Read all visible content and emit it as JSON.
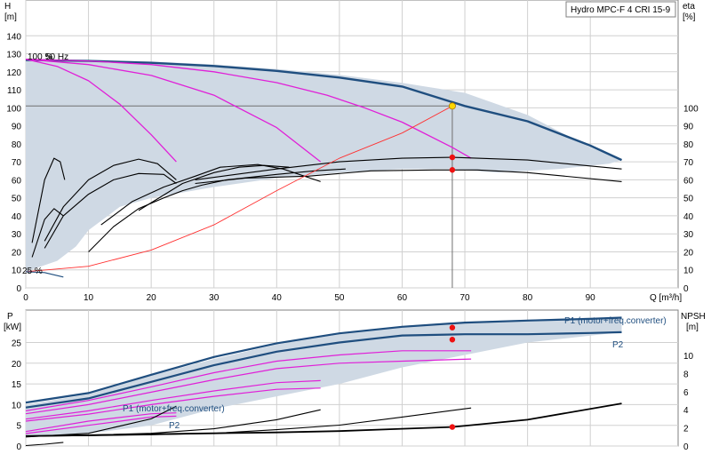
{
  "chart_data": [
    {
      "type": "line",
      "title_box": "Hydro MPC-F 4 CRI 15-9",
      "x_label": "Q [m³/h]",
      "y_left_label_1": "H",
      "y_left_label_2": "[m]",
      "y_right_label_1": "eta",
      "y_right_label_2": "[%]",
      "xlim": [
        0,
        104
      ],
      "ylim": [
        0,
        150
      ],
      "x_ticks": [
        0,
        10,
        20,
        30,
        40,
        50,
        60,
        70,
        80,
        90
      ],
      "y_left_ticks": [
        0,
        10,
        20,
        30,
        40,
        50,
        60,
        70,
        80,
        90,
        100,
        110,
        120,
        130,
        140
      ],
      "y_right_ticks": [
        0,
        10,
        20,
        30,
        40,
        50,
        60,
        70,
        80,
        90,
        100
      ],
      "annotations": {
        "max_speed": "100 %",
        "frequency": "50 Hz",
        "min_speed": "25 %"
      },
      "colors": {
        "region_fill": "#cfd9e4",
        "max_curve": "#1f4e7f",
        "pump_curves": "#e020d8",
        "efficiency": "#000000",
        "system_curve": "#ff3030",
        "duty_point": "#ffd700"
      },
      "operating_region": [
        [
          0,
          127
        ],
        [
          10,
          126.6
        ],
        [
          20,
          125.7
        ],
        [
          30,
          124.1
        ],
        [
          40,
          121.6
        ],
        [
          50,
          118.3
        ],
        [
          60,
          113.9
        ],
        [
          70,
          108.3
        ],
        [
          80,
          96
        ],
        [
          90,
          78
        ],
        [
          95,
          71
        ],
        [
          93,
          69
        ],
        [
          85,
          66
        ],
        [
          75,
          64
        ],
        [
          68,
          66
        ],
        [
          60,
          66
        ],
        [
          50,
          64
        ],
        [
          40,
          61
        ],
        [
          30,
          56
        ],
        [
          20,
          50
        ],
        [
          15,
          45
        ],
        [
          10,
          32
        ],
        [
          8,
          23
        ],
        [
          5,
          15
        ],
        [
          0,
          9
        ]
      ],
      "series": [
        {
          "kind": "max",
          "x": [
            0,
            10,
            20,
            30,
            40,
            50,
            60,
            70,
            80,
            90,
            95
          ],
          "y": [
            126.5,
            126,
            125,
            123.2,
            120.5,
            116.8,
            111.8,
            101,
            92.5,
            79,
            71
          ]
        },
        {
          "kind": "pump",
          "x": [
            0,
            10,
            20,
            30,
            40,
            48,
            54,
            60,
            68,
            71
          ],
          "y": [
            127,
            126,
            124,
            120,
            114,
            107,
            100,
            92,
            78,
            72
          ]
        },
        {
          "kind": "pump",
          "x": [
            0,
            10,
            20,
            30,
            40,
            47
          ],
          "y": [
            127,
            124,
            118,
            107,
            89,
            70
          ]
        },
        {
          "kind": "pump",
          "x": [
            0,
            5,
            10,
            15,
            20,
            24
          ],
          "y": [
            127,
            123,
            115,
            102,
            85,
            70
          ]
        },
        {
          "kind": "eta",
          "x": [
            27,
            35,
            45,
            55,
            65,
            72,
            80,
            95
          ],
          "y": [
            58,
            61,
            62,
            65,
            65.5,
            65.5,
            64,
            59
          ]
        },
        {
          "kind": "eta",
          "x": [
            27,
            40,
            50,
            60,
            68,
            80,
            95
          ],
          "y": [
            60,
            66,
            70,
            72,
            72.5,
            71,
            66
          ]
        },
        {
          "kind": "eta",
          "x": [
            10,
            14,
            18,
            22,
            25,
            28,
            32,
            40,
            46,
            51
          ],
          "y": [
            20,
            34,
            44,
            50,
            54,
            57,
            60,
            63,
            65,
            66
          ]
        },
        {
          "kind": "eta",
          "x": [
            12,
            17,
            22,
            27,
            31,
            37,
            41,
            47
          ],
          "y": [
            35,
            48,
            56,
            62,
            67,
            68.5,
            66,
            59
          ]
        },
        {
          "kind": "eta",
          "x": [
            18,
            25,
            30,
            34,
            38,
            42
          ],
          "y": [
            43,
            58,
            64,
            67,
            68,
            67
          ]
        },
        {
          "kind": "eta",
          "x": [
            3,
            6,
            10,
            14,
            18,
            21,
            24
          ],
          "y": [
            26,
            45,
            60,
            68,
            71.5,
            69,
            60
          ]
        },
        {
          "kind": "eta",
          "x": [
            3,
            6,
            10,
            14,
            18,
            22,
            24
          ],
          "y": [
            22,
            40,
            52,
            60,
            63.5,
            63,
            58
          ]
        },
        {
          "kind": "eta",
          "x": [
            1,
            3,
            4.5,
            5.5,
            6.2
          ],
          "y": [
            25,
            60,
            72,
            70,
            60
          ]
        },
        {
          "kind": "eta",
          "x": [
            1,
            3,
            4.5,
            6
          ],
          "y": [
            17,
            38,
            44,
            40
          ]
        },
        {
          "kind": "system",
          "x": [
            0,
            10,
            20,
            30,
            40,
            50,
            60,
            68
          ],
          "y": [
            9,
            12,
            21,
            35,
            54,
            72,
            86,
            101
          ]
        }
      ],
      "duty_point": {
        "x": 68,
        "y": 101
      },
      "eta_points": [
        {
          "x": 68,
          "y": 72.5
        },
        {
          "x": 68,
          "y": 65.5
        }
      ]
    },
    {
      "type": "line",
      "y_left_label_1": "P",
      "y_left_label_2": "[kW]",
      "y_right_label_1": "NPSH",
      "y_right_label_2": "[m]",
      "xlim": [
        0,
        104
      ],
      "ylim": [
        0,
        32.5
      ],
      "y_left_ticks": [
        0,
        5,
        10,
        15,
        20,
        25
      ],
      "y_right_ticks": [
        0,
        2,
        4,
        6,
        8,
        10
      ],
      "labels": {
        "p1_right": "P1 (motor+freq.converter)",
        "p2_right": "P2",
        "p1_left": "P1 (motor+freq.converter)",
        "p2_left": "P2"
      },
      "power_region": [
        [
          0,
          10
        ],
        [
          10,
          12.5
        ],
        [
          20,
          17
        ],
        [
          30,
          21
        ],
        [
          40,
          24.5
        ],
        [
          50,
          27
        ],
        [
          60,
          29
        ],
        [
          70,
          30
        ],
        [
          80,
          30.5
        ],
        [
          90,
          31
        ],
        [
          95,
          31
        ],
        [
          95,
          27.5
        ],
        [
          80,
          25
        ],
        [
          70,
          22
        ],
        [
          60,
          19
        ],
        [
          50,
          15
        ],
        [
          40,
          12
        ],
        [
          30,
          9
        ],
        [
          20,
          5
        ],
        [
          10,
          3
        ],
        [
          0,
          2.5
        ]
      ],
      "series": [
        {
          "kind": "p1max",
          "x": [
            0,
            10,
            20,
            30,
            40,
            50,
            60,
            70,
            80,
            90,
            95
          ],
          "y": [
            10.5,
            12.8,
            17.2,
            21.5,
            24.8,
            27.2,
            28.8,
            29.8,
            30.3,
            30.7,
            31
          ]
        },
        {
          "kind": "p2max",
          "x": [
            0,
            10,
            20,
            30,
            40,
            50,
            60,
            70,
            80,
            90,
            95
          ],
          "y": [
            9.3,
            11.5,
            15.5,
            19.5,
            22.8,
            25,
            26.7,
            27,
            27,
            27.3,
            27.5
          ]
        },
        {
          "kind": "p1mid",
          "x": [
            0,
            10,
            20,
            30,
            40,
            50,
            60,
            71
          ],
          "y": [
            8.5,
            11,
            14.3,
            17.7,
            20.5,
            22,
            23,
            23
          ]
        },
        {
          "kind": "p2mid",
          "x": [
            0,
            10,
            20,
            30,
            40,
            50,
            60,
            71
          ],
          "y": [
            7.8,
            10,
            13,
            16,
            18.7,
            20,
            20.5,
            21
          ]
        },
        {
          "kind": "p1low",
          "x": [
            0,
            10,
            20,
            30,
            40,
            47
          ],
          "y": [
            6.5,
            8.5,
            11,
            13.3,
            15.3,
            15.8
          ]
        },
        {
          "kind": "p2low",
          "x": [
            0,
            10,
            20,
            30,
            40,
            47
          ],
          "y": [
            6,
            7.7,
            10,
            12,
            13.7,
            14
          ]
        },
        {
          "kind": "p1min",
          "x": [
            0,
            10,
            20,
            24
          ],
          "y": [
            3.5,
            6,
            7.8,
            8
          ]
        },
        {
          "kind": "p2min",
          "x": [
            0,
            10,
            20,
            24
          ],
          "y": [
            3,
            5,
            7,
            7.2
          ]
        }
      ],
      "npsh_series": [
        {
          "x": [
            0,
            10,
            20,
            30,
            40,
            50,
            60,
            68,
            80,
            95
          ],
          "y": [
            1.1,
            1.2,
            1.3,
            1.4,
            1.5,
            1.65,
            1.9,
            2.1,
            2.9,
            4.7
          ]
        },
        {
          "x": [
            0,
            10,
            20,
            30,
            40,
            50,
            60,
            71
          ],
          "y": [
            1.1,
            1.15,
            1.25,
            1.4,
            1.8,
            2.3,
            3.2,
            4.2
          ]
        },
        {
          "x": [
            0,
            10,
            20,
            30,
            40,
            47
          ],
          "y": [
            1.1,
            1.2,
            1.4,
            1.9,
            2.9,
            4.0
          ]
        },
        {
          "x": [
            0,
            10,
            20,
            24
          ],
          "y": [
            1.0,
            1.4,
            3.0,
            4.4
          ]
        },
        {
          "x": [
            0,
            3,
            6
          ],
          "y": [
            0.05,
            0.2,
            0.4
          ]
        }
      ],
      "power_points": [
        {
          "x": 68,
          "y": 28.6
        },
        {
          "x": 68,
          "y": 25.7
        }
      ],
      "npsh_point": {
        "x": 68,
        "y": 2.1
      }
    }
  ]
}
